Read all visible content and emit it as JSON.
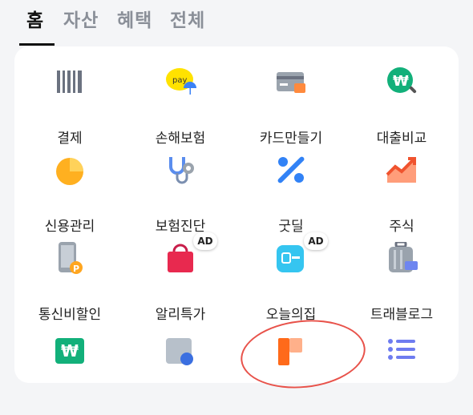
{
  "tabs": [
    {
      "label": "홈",
      "active": true
    },
    {
      "label": "자산",
      "active": false
    },
    {
      "label": "혜택",
      "active": false
    },
    {
      "label": "전체",
      "active": false
    }
  ],
  "grid_items": [
    {
      "label": "결제",
      "icon": "barcode-icon"
    },
    {
      "label": "손해보험",
      "icon": "pay-umbrella-icon"
    },
    {
      "label": "카드만들기",
      "icon": "card-icon"
    },
    {
      "label": "대출비교",
      "icon": "won-search-icon"
    },
    {
      "label": "신용관리",
      "icon": "credit-gauge-icon"
    },
    {
      "label": "보험진단",
      "icon": "stethoscope-icon"
    },
    {
      "label": "굿딜",
      "icon": "percent-icon"
    },
    {
      "label": "주식",
      "icon": "stock-chart-icon"
    },
    {
      "label": "통신비할인",
      "icon": "phone-discount-icon"
    },
    {
      "label": "알리특가",
      "icon": "shopping-bag-icon",
      "badge": "AD"
    },
    {
      "label": "오늘의집",
      "icon": "home-app-icon",
      "badge": "AD"
    },
    {
      "label": "트래블로그",
      "icon": "suitcase-icon"
    },
    {
      "label": "",
      "icon": "won-card-icon"
    },
    {
      "label": "",
      "icon": "folder-icon"
    },
    {
      "label": "",
      "icon": "orange-bookmark-icon"
    },
    {
      "label": "",
      "icon": "list-icon"
    }
  ],
  "colors": {
    "accent_blue": "#3182f6",
    "orange": "#ff7a1a",
    "green": "#11a86f",
    "annotation_red": "#e8524a"
  }
}
